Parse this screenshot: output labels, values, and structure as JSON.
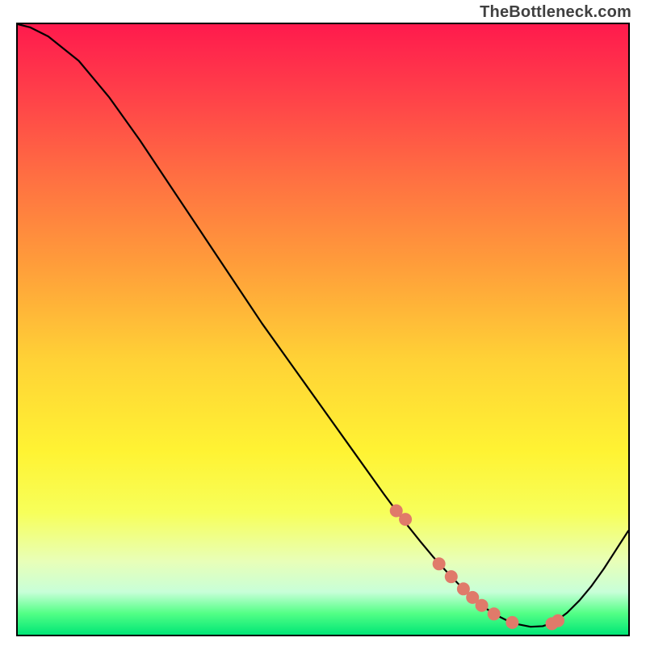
{
  "attribution": "TheBottleneck.com",
  "chart_data": {
    "type": "line",
    "title": "",
    "xlabel": "",
    "ylabel": "",
    "xlim": [
      0,
      100
    ],
    "ylim": [
      0,
      100
    ],
    "series": [
      {
        "name": "curve",
        "x": [
          0,
          2,
          5,
          10,
          15,
          20,
          25,
          30,
          35,
          40,
          45,
          50,
          55,
          60,
          62,
          64,
          66,
          68,
          70,
          72,
          74,
          76,
          78,
          80,
          82,
          84,
          86,
          88,
          90,
          92,
          94,
          96,
          98,
          100
        ],
        "y": [
          100,
          99.5,
          98,
          94,
          88,
          81,
          73.5,
          66,
          58.5,
          51,
          44,
          37,
          30,
          23,
          20.3,
          17.7,
          15.2,
          12.8,
          10.6,
          8.5,
          6.5,
          4.8,
          3.4,
          2.4,
          1.7,
          1.3,
          1.4,
          2.1,
          3.6,
          5.6,
          8.0,
          10.8,
          13.9,
          17.0
        ]
      },
      {
        "name": "highlight-markers",
        "x": [
          62,
          63.5,
          69,
          71,
          73,
          74.5,
          76,
          78,
          81,
          87.5,
          88.5
        ],
        "y": [
          20.3,
          18.9,
          11.6,
          9.5,
          7.5,
          6.1,
          4.8,
          3.4,
          2.0,
          1.8,
          2.3
        ]
      }
    ],
    "gradient": {
      "top_color": "#ff1a4d",
      "mid_color": "#fff333",
      "bottom_color": "#00e676"
    }
  }
}
